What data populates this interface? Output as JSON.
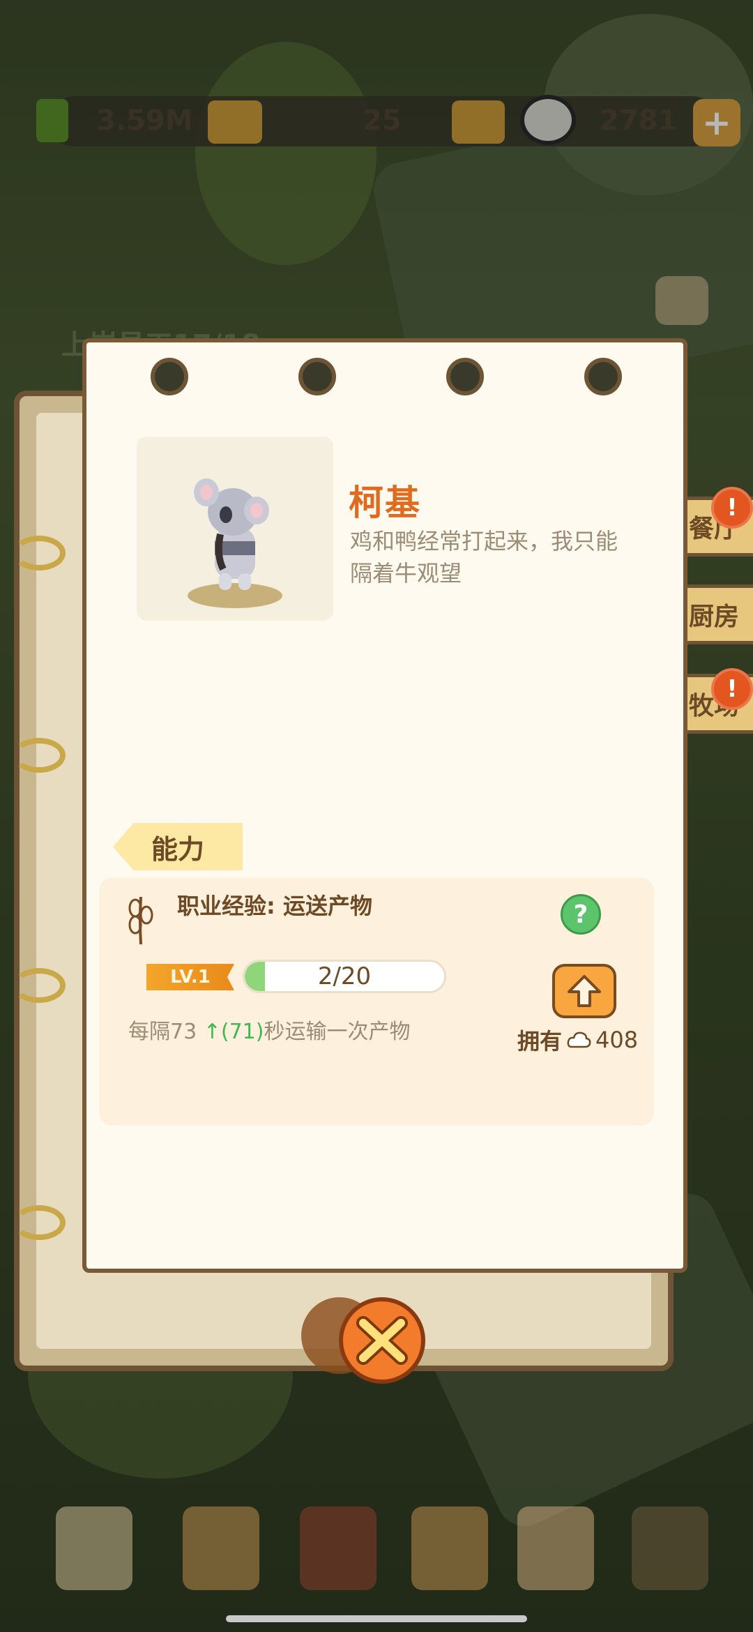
{
  "resources": {
    "money": "3.59M",
    "orders": "25",
    "panda_count": "2781",
    "staff_label": "上岸员工17/18"
  },
  "side_tabs": [
    {
      "label": "餐厅",
      "badge": "!"
    },
    {
      "label": "厨房",
      "badge": ""
    },
    {
      "label": "牧场",
      "badge": "!"
    }
  ],
  "character": {
    "name": "柯基",
    "description": "鸡和鸭经常打起来，我只能隔着牛观望"
  },
  "ability": {
    "tab_label": "能力",
    "job_label": "职业经验:  运送产物",
    "level": "LV.1",
    "progress_text": "2/20",
    "progress_value": 0.1,
    "interval_prefix": "每隔73 ",
    "interval_arrow": "↑",
    "interval_new": "(71)",
    "interval_suffix": "秒运输一次产物",
    "help_symbol": "?",
    "own_label": "拥有",
    "own_count": "408"
  },
  "colors": {
    "accent": "#e06b1f",
    "progress": "#8fd67a",
    "help": "#5cc46a",
    "upgrade": "#f7a640"
  },
  "icons": {
    "close": "close-icon",
    "upgrade": "up-arrow-icon",
    "help": "question-icon",
    "wheat": "wheat-icon",
    "cloud": "cloud-icon"
  }
}
